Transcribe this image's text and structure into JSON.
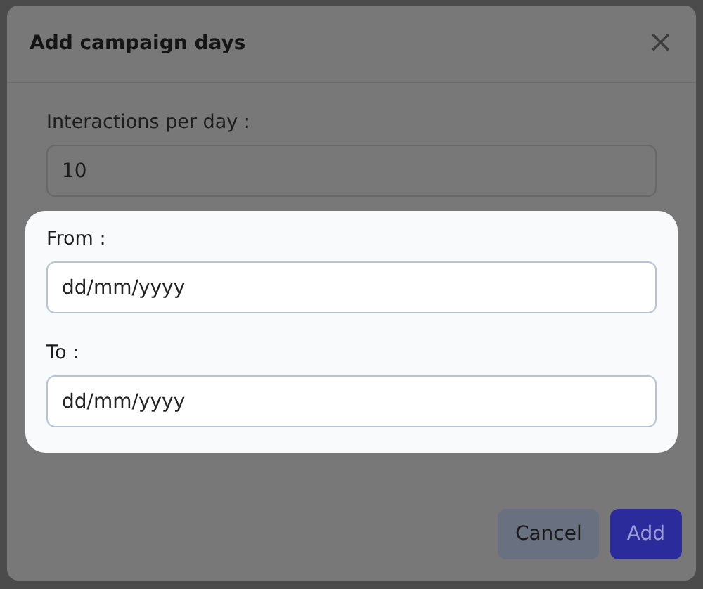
{
  "dialog": {
    "title": "Add campaign days",
    "close": "×",
    "interactions": {
      "label": "Interactions per day :",
      "value": "10"
    },
    "date_fields": [
      {
        "label": "From :",
        "placeholder": "dd/mm/yyyy"
      },
      {
        "label": "To :",
        "placeholder": "dd/mm/yyyy"
      }
    ],
    "buttons": [
      {
        "label": "Cancel",
        "kind": "secondary"
      },
      {
        "label": "Add",
        "kind": "primary"
      }
    ]
  }
}
